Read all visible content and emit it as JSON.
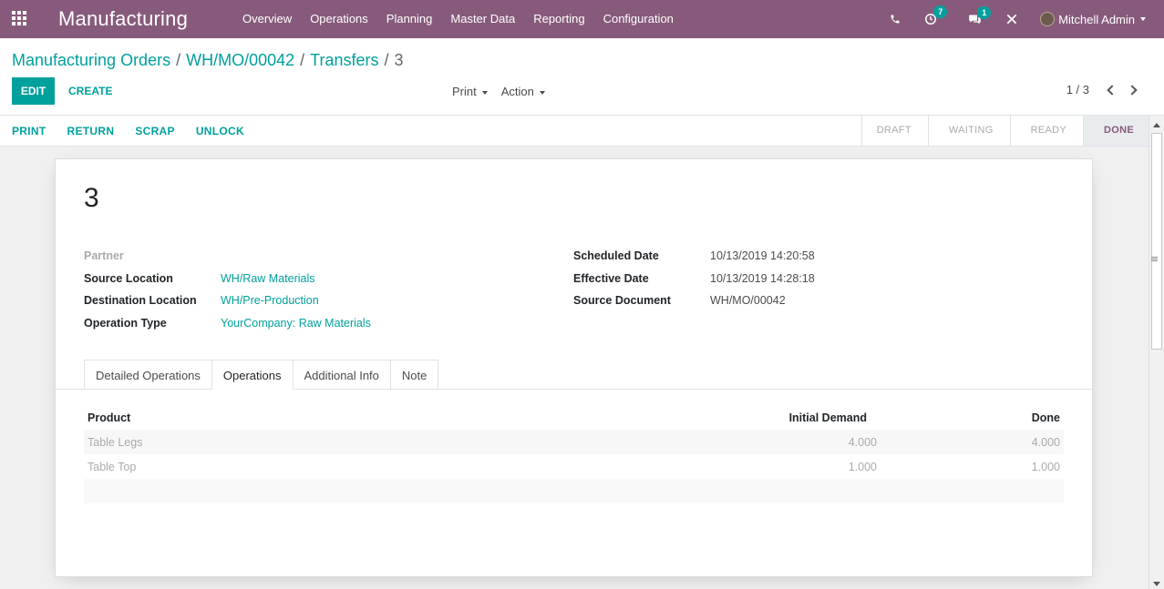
{
  "navbar": {
    "app_name": "Manufacturing",
    "menu": [
      "Overview",
      "Operations",
      "Planning",
      "Master Data",
      "Reporting",
      "Configuration"
    ],
    "activity_count": "7",
    "message_count": "1",
    "user_name": "Mitchell Admin"
  },
  "breadcrumb": {
    "items": [
      "Manufacturing Orders",
      "WH/MO/00042",
      "Transfers"
    ],
    "current": "3"
  },
  "toolbar": {
    "edit_label": "EDIT",
    "create_label": "CREATE",
    "print_label": "Print",
    "action_label": "Action",
    "pager": "1 / 3"
  },
  "header_buttons": [
    "PRINT",
    "RETURN",
    "SCRAP",
    "UNLOCK"
  ],
  "states": {
    "items": [
      "DRAFT",
      "WAITING",
      "READY",
      "DONE"
    ],
    "active": "DONE"
  },
  "record": {
    "title": "3",
    "left_fields": [
      {
        "label": "Partner",
        "value": ""
      },
      {
        "label": "Source Location",
        "value": "WH/Raw Materials"
      },
      {
        "label": "Destination Location",
        "value": "WH/Pre-Production"
      },
      {
        "label": "Operation Type",
        "value": "YourCompany: Raw Materials"
      }
    ],
    "right_fields": [
      {
        "label": "Scheduled Date",
        "value": "10/13/2019 14:20:58"
      },
      {
        "label": "Effective Date",
        "value": "10/13/2019 14:28:18"
      },
      {
        "label": "Source Document",
        "value": "WH/MO/00042"
      }
    ]
  },
  "tabs": {
    "items": [
      "Detailed Operations",
      "Operations",
      "Additional Info",
      "Note"
    ],
    "active": "Operations"
  },
  "table": {
    "headers": [
      "Product",
      "Initial Demand",
      "Done"
    ],
    "rows": [
      [
        "Table Legs",
        "4.000",
        "4.000"
      ],
      [
        "Table Top",
        "1.000",
        "1.000"
      ]
    ]
  },
  "colors": {
    "brand": "#875a7b",
    "accent": "#00a09d"
  }
}
